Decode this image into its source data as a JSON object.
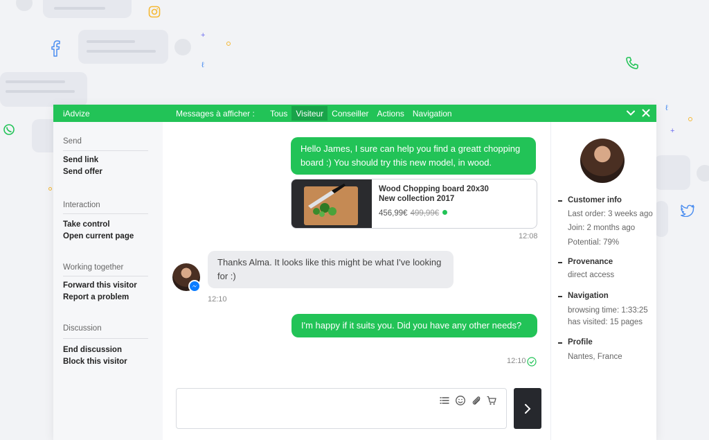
{
  "window": {
    "brand": "iAdvize"
  },
  "topbar": {
    "messages_label": "Messages à afficher :",
    "tabs": [
      {
        "label": "Tous",
        "active": false
      },
      {
        "label": "Visiteur",
        "active": true
      },
      {
        "label": "Conseiller",
        "active": false
      },
      {
        "label": "Actions",
        "active": false
      },
      {
        "label": "Navigation",
        "active": false
      }
    ],
    "icons": [
      "chevron-down-icon",
      "close-icon"
    ]
  },
  "sidebar": {
    "sections": [
      {
        "title": "Send",
        "actions": [
          "Send link",
          "Send offer"
        ]
      },
      {
        "title": "Interaction",
        "actions": [
          "Take control",
          "Open current page"
        ]
      },
      {
        "title": "Working together",
        "actions": [
          "Forward this visitor",
          "Report a problem"
        ]
      },
      {
        "title": "Discussion",
        "actions": [
          "End discussion",
          "Block this visitor"
        ]
      }
    ]
  },
  "chat": {
    "messages": [
      {
        "from": "agent",
        "text": "Hello James, I sure can help you find a greatt chopping board :) You should try this new model, in wood."
      },
      {
        "from": "visitor",
        "text": "Thanks Alma. It looks like this might be what I've looking for :)",
        "time": "12:10"
      },
      {
        "from": "agent",
        "text": "I'm happy if it suits you. Did you have any other needs?",
        "time": "12:10"
      }
    ],
    "product": {
      "name_line1": "Wood Chopping board 20x30",
      "name_line2": "New collection 2017",
      "price": "456,99€",
      "old_price": "499,99€"
    },
    "product_time": "12:08"
  },
  "composer": {
    "icons": [
      "list-icon",
      "emoji-icon",
      "attachment-icon",
      "cart-icon"
    ],
    "send_icon": "chevron-right-icon"
  },
  "customer": {
    "info_title": "Customer info",
    "last_order": "Last order: 3 weeks ago",
    "join": "Join: 2 months ago",
    "potential": "Potential: 79%",
    "provenance_title": "Provenance",
    "provenance": "direct access",
    "navigation_title": "Navigation",
    "browsing_time": "browsing time: 1:33:25",
    "visited": "has visited: 15 pages",
    "profile_title": "Profile",
    "location": "Nantes, France"
  },
  "colors": {
    "accent": "#22c357",
    "dark": "#26282d",
    "messenger": "#0b7cff"
  }
}
